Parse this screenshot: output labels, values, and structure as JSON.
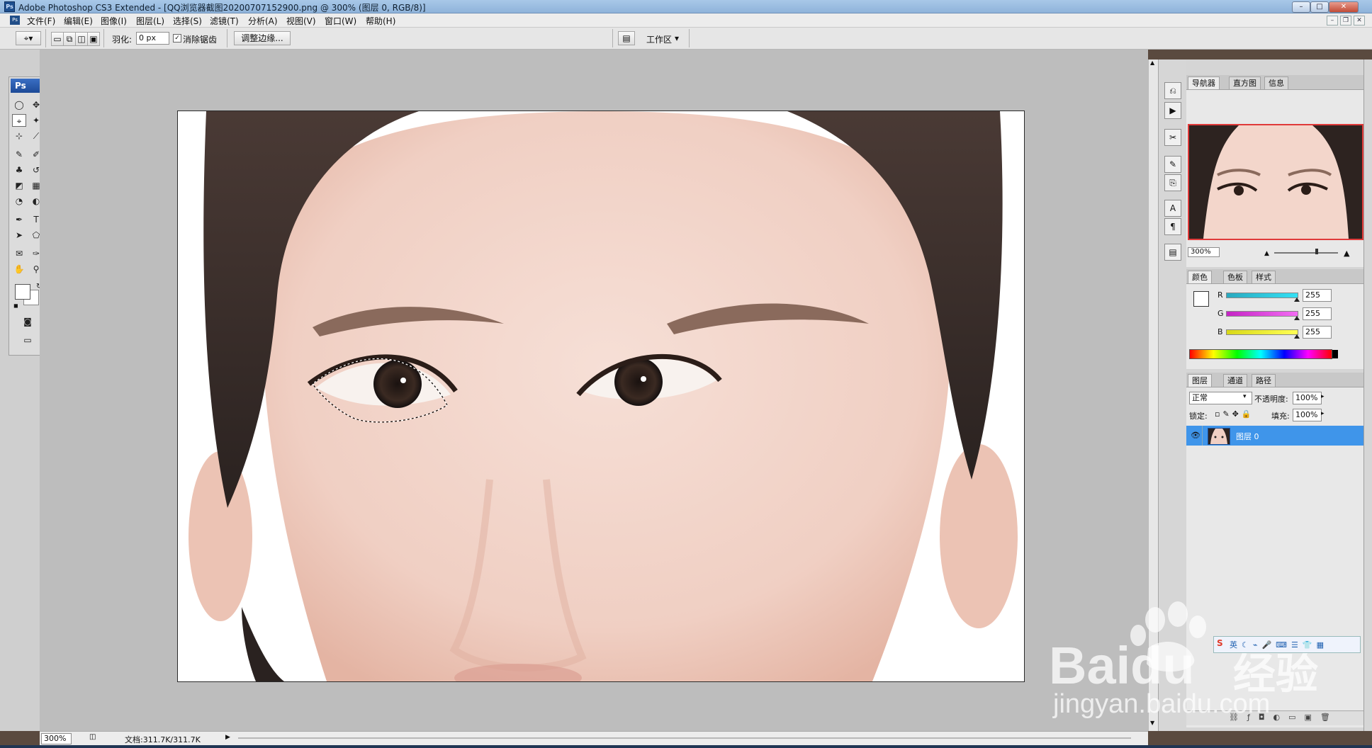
{
  "window": {
    "title": "Adobe Photoshop CS3 Extended - [QQ浏览器截图20200707152900.png @ 300% (图层 0, RGB/8)]",
    "ps_logo": "Ps"
  },
  "menubar": {
    "items": [
      "文件(F)",
      "编辑(E)",
      "图像(I)",
      "图层(L)",
      "选择(S)",
      "滤镜(T)",
      "分析(A)",
      "视图(V)",
      "窗口(W)",
      "帮助(H)"
    ]
  },
  "options": {
    "feather_label": "羽化:",
    "feather_value": "0 px",
    "antialias_label": "消除锯齿",
    "refine_edge_label": "调整边缘...",
    "workspace_label": "工作区"
  },
  "toolbox": {
    "logo": "Ps"
  },
  "status": {
    "zoom": "300%",
    "doc_size": "文档:311.7K/311.7K"
  },
  "navigator": {
    "tabs": [
      "导航器",
      "直方图",
      "信息"
    ],
    "zoom": "300%"
  },
  "color_panel": {
    "tabs": [
      "颜色",
      "色板",
      "样式"
    ],
    "channels": [
      {
        "label": "R",
        "value": "255",
        "color_from": "#2aa9bf",
        "color_to": "#33e0f4"
      },
      {
        "label": "G",
        "value": "255",
        "color_from": "#c424c4",
        "color_to": "#f36cf3"
      },
      {
        "label": "B",
        "value": "255",
        "color_from": "#d8d818",
        "color_to": "#ffff55"
      }
    ]
  },
  "layers_panel": {
    "tabs": [
      "图层",
      "通道",
      "路径"
    ],
    "blend_mode": "正常",
    "opacity_label": "不透明度:",
    "opacity_value": "100%",
    "lock_label": "锁定:",
    "fill_label": "填充:",
    "fill_value": "100%",
    "layers": [
      {
        "name": "图层 0",
        "selected": true,
        "visible": true
      }
    ]
  },
  "watermark": {
    "brand": "Baidu",
    "brand_cn": "经验",
    "url": "jingyan.baidu.com"
  },
  "colors": {
    "selection_highlight": "#3f95ea",
    "navigator_frame": "#e03a3a"
  }
}
